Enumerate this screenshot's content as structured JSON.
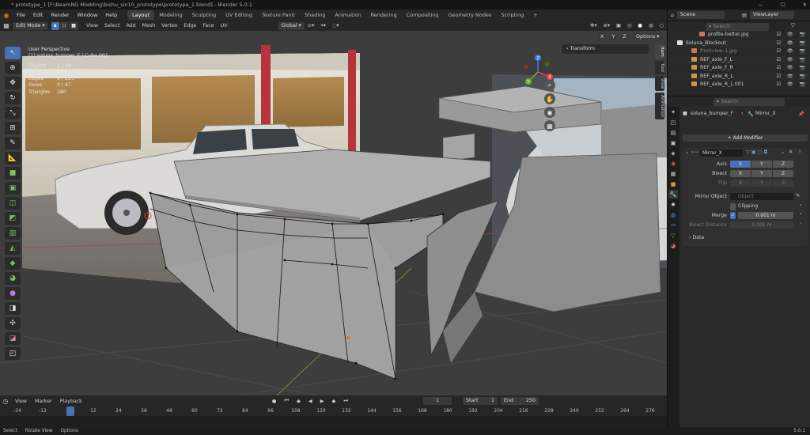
{
  "window": {
    "title": "* prototype_1 [F:\\BeamNG Modding\\bishu_sin10_prototype\\prototype_1.blend] - Blender 5.0.1",
    "min": "—",
    "max": "☐",
    "close": "✕"
  },
  "menu": [
    "File",
    "Edit",
    "Render",
    "Window",
    "Help"
  ],
  "workspaces": [
    {
      "label": "Layout",
      "active": true
    },
    {
      "label": "Modeling"
    },
    {
      "label": "Sculpting"
    },
    {
      "label": "UV Editing"
    },
    {
      "label": "Texture Paint"
    },
    {
      "label": "Shading"
    },
    {
      "label": "Animation"
    },
    {
      "label": "Rendering"
    },
    {
      "label": "Compositing"
    },
    {
      "label": "Geometry Nodes"
    },
    {
      "label": "Scripting"
    },
    {
      "label": "+"
    }
  ],
  "viewport_header": {
    "mode": "Edit Mode",
    "menus": [
      "View",
      "Select",
      "Add",
      "Mesh",
      "Vertex",
      "Edge",
      "Face",
      "UV"
    ],
    "orientation": "Global",
    "axes": [
      "X",
      "Y",
      "Z"
    ],
    "options": "Options"
  },
  "overlay": {
    "view": "User Perspective",
    "object": "(1) soluna_bumper_F | Cube.001",
    "stats": [
      {
        "k": "Objects",
        "v": "1 / 19"
      },
      {
        "k": "Vertices",
        "v": "0 / 173"
      },
      {
        "k": "Edges",
        "v": "0 / 225"
      },
      {
        "k": "Faces",
        "v": "0 / 47"
      },
      {
        "k": "Triangles",
        "v": "180"
      }
    ]
  },
  "sidebar": {
    "transform_label": "Transform",
    "tabs": [
      "Item",
      "Tool",
      "View",
      "Animation"
    ]
  },
  "gizmo": {
    "x": "X",
    "y": "Y",
    "z": "Z"
  },
  "timeline": {
    "menus": [
      "View",
      "Marker",
      "Playback"
    ],
    "current_frame": "1",
    "start_label": "Start",
    "start": "1",
    "end_label": "End",
    "end": "250",
    "ticks": [
      "-24",
      "-12",
      "1",
      "12",
      "24",
      "36",
      "48",
      "60",
      "72",
      "84",
      "96",
      "108",
      "120",
      "132",
      "144",
      "156",
      "168",
      "180",
      "192",
      "204",
      "216",
      "228",
      "240",
      "252",
      "264",
      "276"
    ]
  },
  "statusbar": {
    "items": [
      "Select",
      "Rotate View",
      "Options"
    ],
    "version": "5.0.1"
  },
  "scene": {
    "label": "Scene",
    "view_layer": "ViewLayer"
  },
  "outliner": {
    "search_placeholder": "Search",
    "rows": [
      {
        "label": "profile-better.jpg",
        "indent": 40,
        "color": "#c87a4a"
      },
      {
        "label": "Soluna_Blockout",
        "indent": 12,
        "color": "#dddddd"
      },
      {
        "label": "frontview-1.jpg",
        "indent": 30,
        "color": "#c87a4a",
        "dim": true
      },
      {
        "label": "REF_axle_F_L",
        "indent": 30,
        "color": "#d4924f"
      },
      {
        "label": "REF_axle_F_R",
        "indent": 30,
        "color": "#d4924f"
      },
      {
        "label": "REF_axle_R_L",
        "indent": 30,
        "color": "#d4924f"
      },
      {
        "label": "REF_axle_R_L.001",
        "indent": 30,
        "color": "#d4924f"
      }
    ]
  },
  "properties": {
    "search_placeholder": "Search",
    "object": "soluna_bumper_F",
    "modifier_crumb": "Mirror_X",
    "add_modifier": "Add Modifier",
    "modifier_name": "Mirror_X",
    "axis_label": "Axis",
    "bisect_label": "Bisect",
    "flip_label": "Flip",
    "axes": [
      "X",
      "Y",
      "Z"
    ],
    "mirror_object_label": "Mirror Object",
    "mirror_object_placeholder": "Object",
    "clipping_label": "Clipping",
    "merge_label": "Merge",
    "merge_value": "0.001 m",
    "bisect_distance_label": "Bisect Distance",
    "bisect_distance_value": "0.001 m",
    "data_label": "Data"
  },
  "colors": {
    "accent": "#4772b3",
    "x_axis": "#e8434f",
    "y_axis": "#6eb12e",
    "z_axis": "#3d7de3"
  }
}
